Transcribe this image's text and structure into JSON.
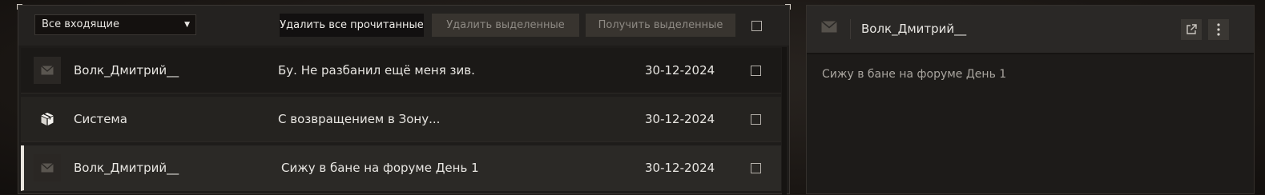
{
  "inbox": {
    "filter_selected": "Все входящие",
    "delete_read_label": "Удалить все прочитанные",
    "delete_selected_label": "Удалить выделенные",
    "receive_selected_label": "Получить выделенные",
    "messages": [
      {
        "sender": "Волк_Дмитрий__",
        "subject": "Бу. Не разбанил ещё меня зив.",
        "date": "30-12-2024",
        "icon": "envelope-icon"
      },
      {
        "sender": "Система",
        "subject": "С возвращением в Зону...",
        "date": "30-12-2024",
        "icon": "package-icon"
      },
      {
        "sender": "Волк_Дмитрий__",
        "subject": "Сижу в бане на форуме День 1",
        "date": "30-12-2024",
        "icon": "envelope-icon"
      }
    ]
  },
  "reader": {
    "sender": "Волк_Дмитрий__",
    "body": "Сижу в бане на форуме День 1"
  }
}
